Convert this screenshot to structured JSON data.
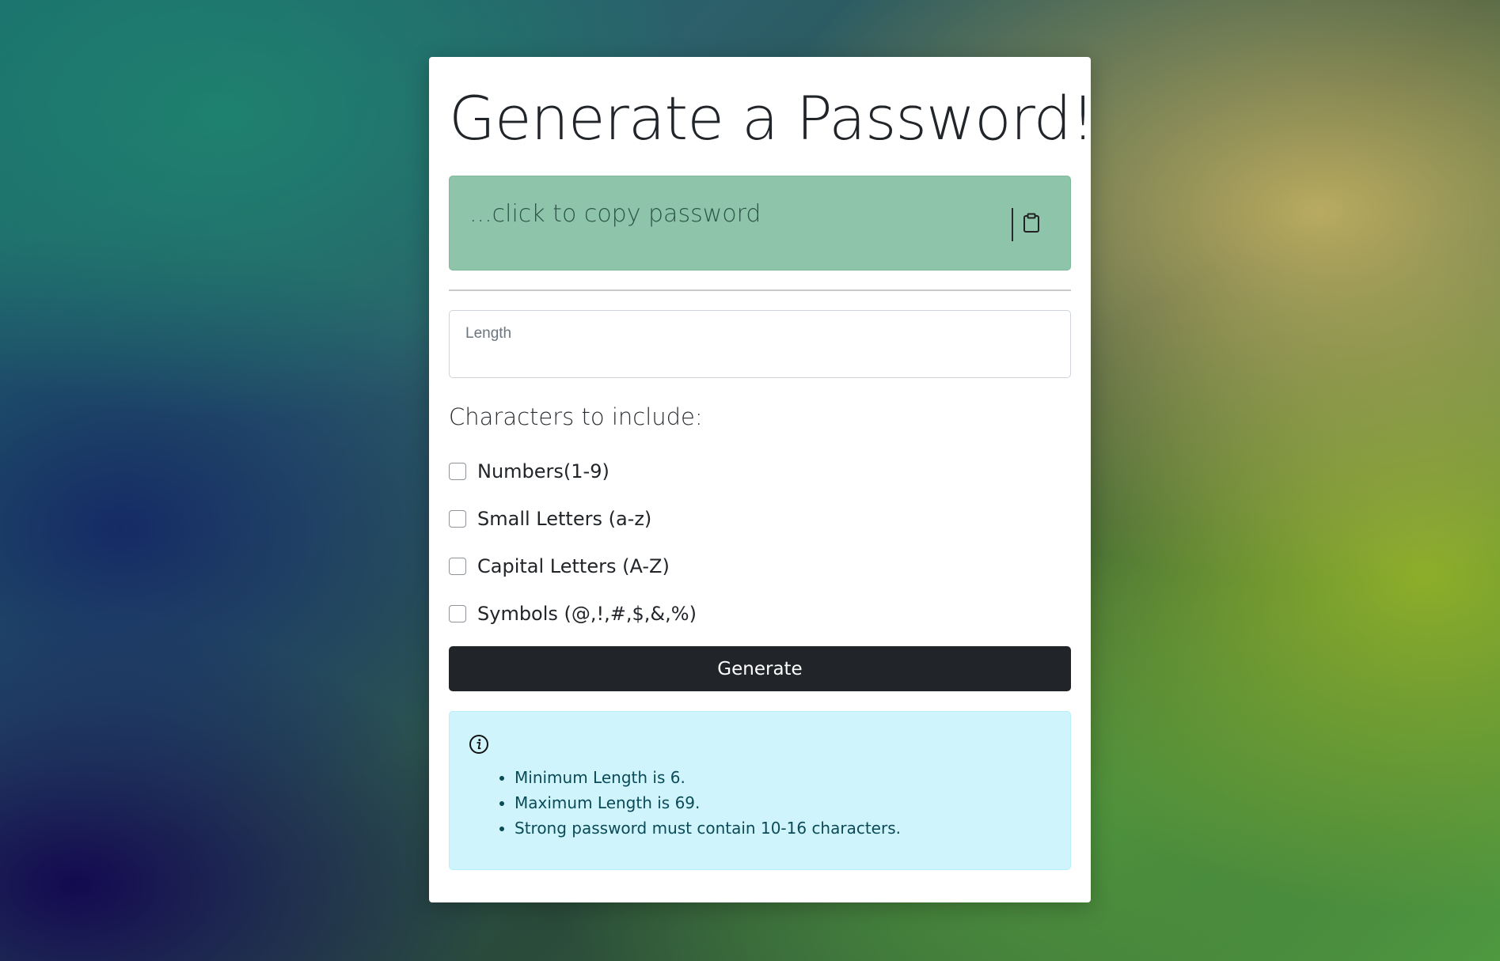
{
  "page": {
    "title": "Generate a Password!"
  },
  "password": {
    "placeholder": "...click to copy password",
    "copy_icon": "clipboard-icon"
  },
  "length": {
    "label": "Length",
    "value": ""
  },
  "characters": {
    "heading": "Characters to include:",
    "options": [
      {
        "label": "Numbers(1-9)",
        "checked": false
      },
      {
        "label": "Small Letters (a-z)",
        "checked": false
      },
      {
        "label": "Capital Letters (A-Z)",
        "checked": false
      },
      {
        "label": "Symbols (@,!,#,$,&,%)",
        "checked": false
      }
    ]
  },
  "actions": {
    "generate_label": "Generate"
  },
  "info": {
    "icon": "info-icon",
    "items": [
      "Minimum Length is 6.",
      "Maximum Length is 69.",
      "Strong password must contain 10-16 characters."
    ]
  },
  "colors": {
    "password_box": "#8ec5aa",
    "generate_button": "#212529",
    "info_box": "#cff4fc"
  }
}
